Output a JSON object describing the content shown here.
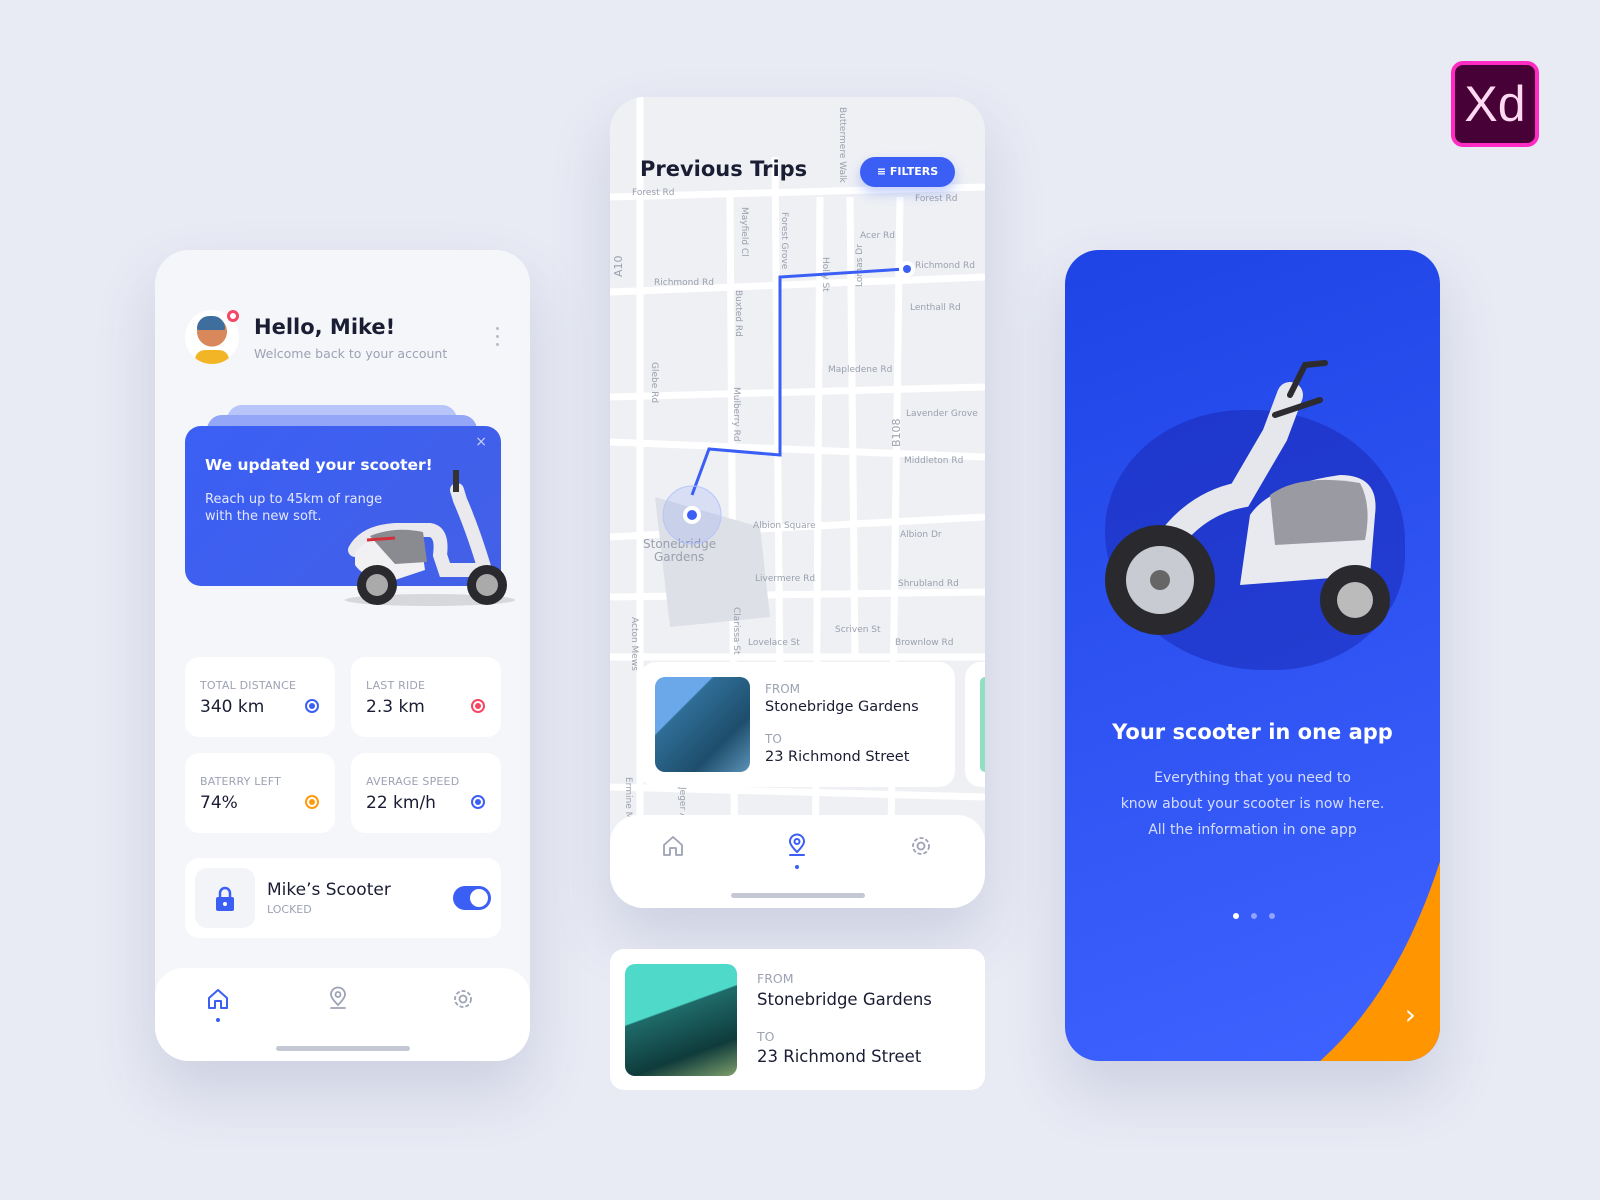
{
  "home": {
    "greeting": "Hello, Mike!",
    "subtitle": "Welcome back to your account",
    "promo": {
      "title": "We updated your scooter!",
      "text": "Reach up to 45km of range with the new soft.",
      "close": "×"
    },
    "stats": [
      {
        "label": "TOTAL DISTANCE",
        "value": "340 km",
        "color": "#3b5ff5"
      },
      {
        "label": "LAST RIDE",
        "value": "2.3 km",
        "color": "#f44766"
      },
      {
        "label": "BATERRY LEFT",
        "value": "74%",
        "color": "#ff9b0f"
      },
      {
        "label": "AVERAGE SPEED",
        "value": "22 km/h",
        "color": "#3b5ff5"
      }
    ],
    "scooter": {
      "name": "Mike’s Scooter",
      "status": "LOCKED",
      "locked": true
    },
    "nav": {
      "active": "home",
      "items": [
        "home-icon",
        "location-pin-icon",
        "gear-icon"
      ]
    }
  },
  "trips": {
    "title": "Previous Trips",
    "filters_label": "FILTERS",
    "map_labels": [
      "Forest Rd",
      "Forest Rd",
      "Acer Rd",
      "Richmond Rd",
      "Richmond Rd",
      "Lenthall Rd",
      "Mapledene Rd",
      "Lavender Grove",
      "Middleton Rd",
      "Albion Square",
      "Albion Dr",
      "Livermere Rd",
      "Shrubland Rd",
      "Scriven St",
      "Lovelace St",
      "Brownlow Rd",
      "Stonebridge Gardens",
      "B108",
      "A10",
      "Holly St",
      "Forest Grove",
      "Mayfield Cl",
      "Buxted Rd",
      "Mulberry Rd",
      "Glebe Rd",
      "Lomas Dr",
      "Clarissa St",
      "Acton Mews",
      "Ermine Mews",
      "Jeger Ave",
      "Buttermere Walk"
    ],
    "card": {
      "from_label": "FROM",
      "from": "Stonebridge Gardens",
      "to_label": "TO",
      "to": "23 Richmond Street"
    },
    "nav": {
      "active": "map"
    }
  },
  "expanded_card": {
    "from_label": "FROM",
    "from": "Stonebridge Gardens",
    "to_label": "TO",
    "to": "23 Richmond Street"
  },
  "onboarding": {
    "title": "Your scooter in one app",
    "lines": [
      "Everything that you need to",
      "know about your scooter is now here.",
      "All the information in one app"
    ],
    "page": 1,
    "pages": 3,
    "next": "›",
    "accent": "#ff9500"
  },
  "xd_logo": "Xd"
}
